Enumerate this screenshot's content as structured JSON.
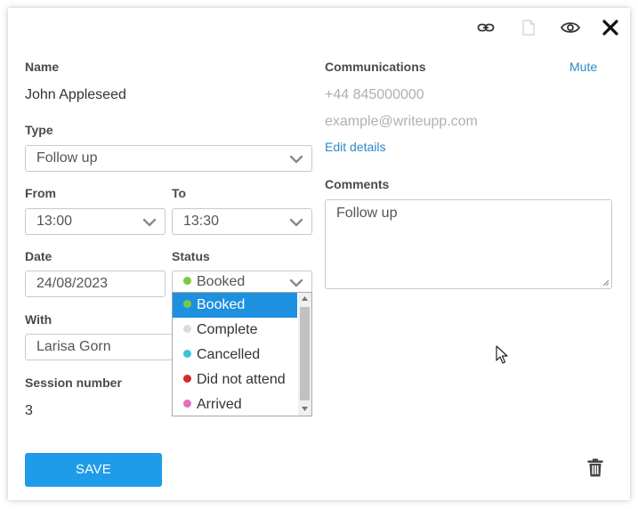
{
  "header_icons": {
    "link": "link-icon",
    "document": "document-icon",
    "eye": "eye-icon",
    "close": "close-icon"
  },
  "name": {
    "label": "Name",
    "value": "John Appleseed"
  },
  "type": {
    "label": "Type",
    "value": "Follow up"
  },
  "from": {
    "label": "From",
    "value": "13:00"
  },
  "to": {
    "label": "To",
    "value": "13:30"
  },
  "date": {
    "label": "Date",
    "value": "24/08/2023"
  },
  "status": {
    "label": "Status",
    "value": "Booked",
    "options": [
      {
        "label": "Booked",
        "color": "#7ac943"
      },
      {
        "label": "Complete",
        "color": "#dcdcdc"
      },
      {
        "label": "Cancelled",
        "color": "#3cc3d8"
      },
      {
        "label": "Did not attend",
        "color": "#d42a2a"
      },
      {
        "label": "Arrived",
        "color": "#e46ec1"
      }
    ]
  },
  "with": {
    "label": "With",
    "value": "Larisa Gorn"
  },
  "session": {
    "label": "Session number",
    "value": "3"
  },
  "communications": {
    "label": "Communications",
    "mute": "Mute",
    "phone": "+44 845000000",
    "email": "example@writeupp.com",
    "edit": "Edit details"
  },
  "comments": {
    "label": "Comments",
    "value": "Follow up"
  },
  "save_label": "SAVE",
  "colors": {
    "accent": "#1e9be9",
    "link": "#2a8ac8",
    "selected": "#1e90e0"
  }
}
